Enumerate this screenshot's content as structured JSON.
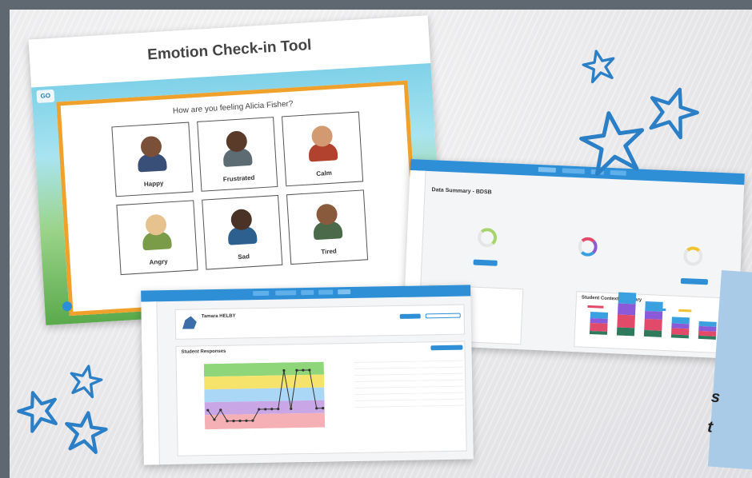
{
  "checkin": {
    "title": "Emotion Check-in Tool",
    "question": "How are you feeling Alicia Fisher?",
    "emotions": [
      "Happy",
      "Frustrated",
      "Calm",
      "Angry",
      "Sad",
      "Tired"
    ]
  },
  "summary": {
    "heading": "Data Summary - BDSB",
    "panel_title": "Student Context Summary"
  },
  "responses": {
    "student_name": "Tamara HELBY",
    "section_title": "Student Responses"
  },
  "note": {
    "line1": "s",
    "line2": "t"
  },
  "colors": {
    "accent_blue": "#2f8fd6",
    "frame_orange": "#f0a12b",
    "star_blue": "#2b7fc6",
    "zone_green": "#8fd67a",
    "zone_yellow": "#f6e36b",
    "zone_blue": "#a9d7f5",
    "zone_purple": "#c9a7e6",
    "zone_pink": "#f5b0b6"
  },
  "icons": {
    "stars": "star-icon",
    "chat": "chat-bubble-icon"
  }
}
